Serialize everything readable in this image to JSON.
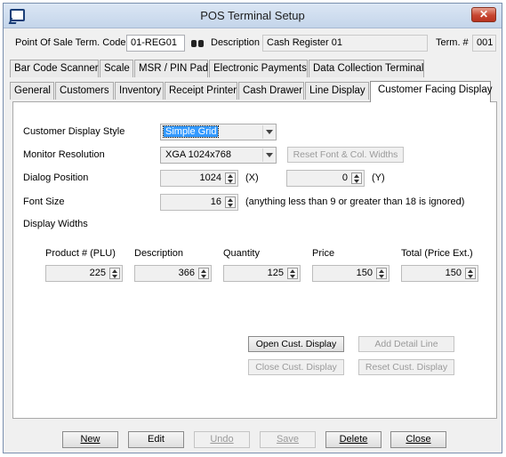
{
  "window": {
    "title": "POS Terminal Setup",
    "close_glyph": "✕"
  },
  "header": {
    "term_code_label": "Point Of Sale Term. Code",
    "term_code_value": "01-REG01",
    "search_icon": "binoculars-icon",
    "description_label": "Description",
    "description_value": "Cash Register 01",
    "term_num_label": "Term. #",
    "term_num_value": "001"
  },
  "tabs_row1": [
    "Bar Code Scanner",
    "Scale",
    "MSR / PIN Pad",
    "Electronic Payments",
    "Data Collection Terminal"
  ],
  "tabs_row2": [
    "General",
    "Customers",
    "Inventory",
    "Receipt Printer",
    "Cash Drawer",
    "Line Display",
    "Customer Facing Display"
  ],
  "active_tab": "Customer Facing Display",
  "panel": {
    "display_style_label": "Customer Display Style",
    "display_style_value": "Simple Grid",
    "monitor_label": "Monitor Resolution",
    "monitor_value": "XGA 1024x768",
    "reset_widths_button": "Reset Font & Col. Widths",
    "dialog_position_label": "Dialog Position",
    "dialog_x_value": "1024",
    "dialog_x_unit": "(X)",
    "dialog_y_value": "0",
    "dialog_y_unit": "(Y)",
    "font_size_label": "Font Size",
    "font_size_value": "16",
    "font_size_note": "(anything less than 9 or greater than 18 is ignored)",
    "display_widths_label": "Display Widths",
    "columns": [
      {
        "label": "Product # (PLU)",
        "value": "225"
      },
      {
        "label": "Description",
        "value": "366"
      },
      {
        "label": "Quantity",
        "value": "125"
      },
      {
        "label": "Price",
        "value": "150"
      },
      {
        "label": "Total (Price Ext.)",
        "value": "150"
      }
    ],
    "open_display_button": "Open Cust. Display",
    "add_detail_button": "Add Detail Line",
    "close_display_button": "Close Cust. Display",
    "reset_display_button": "Reset Cust. Display"
  },
  "footer": {
    "new": "New",
    "edit": "Edit",
    "undo": "Undo",
    "save": "Save",
    "delete": "Delete",
    "close": "Close"
  },
  "colors": {
    "selection": "#3399ff",
    "title_bar": "#c4d5ea",
    "close_button": "#c74631"
  }
}
